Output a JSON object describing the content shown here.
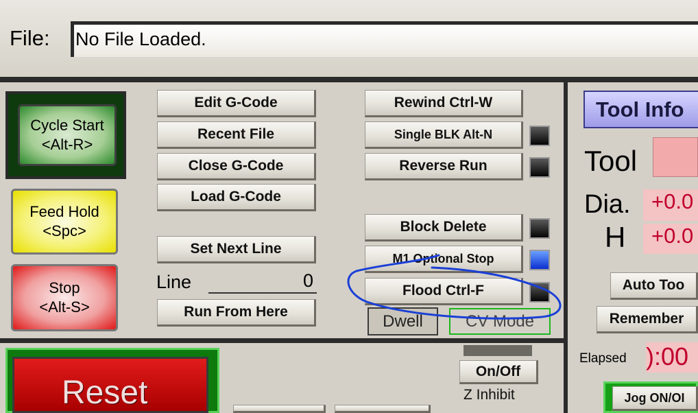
{
  "file": {
    "label": "File:",
    "value": "No File Loaded."
  },
  "buttons": {
    "cycle_start": [
      "Cycle Start",
      "<Alt-R>"
    ],
    "feed_hold": [
      "Feed Hold",
      "<Spc>"
    ],
    "stop": [
      "Stop",
      "<Alt-S>"
    ],
    "edit_gcode": "Edit G-Code",
    "recent_file": "Recent File",
    "close_gcode": "Close G-Code",
    "load_gcode": "Load G-Code",
    "set_next_line": "Set Next Line",
    "run_from_here": "Run From Here",
    "rewind": "Rewind Ctrl-W",
    "single_blk": "Single BLK Alt-N",
    "reverse_run": "Reverse Run",
    "block_delete": "Block Delete",
    "m1_optional_stop": "M1 Optional Stop",
    "flood": "Flood Ctrl-F",
    "dwell": "Dwell",
    "cv_mode": "CV Mode",
    "reset": "Reset",
    "on_off": "On/Off",
    "z_inhibit": "Z Inhibit",
    "auto_tool": "Auto Too",
    "remember": "Remember",
    "jog_on_off": "Jog ON/OI"
  },
  "line": {
    "label": "Line",
    "value": "0"
  },
  "tool_info": {
    "title": "Tool Info",
    "tool_label": "Tool",
    "dia_label": "Dia.",
    "dia_value": "+0.0",
    "h_label": "H",
    "h_value": "+0.0",
    "elapsed_label": "Elapsed",
    "elapsed_value": "):00"
  },
  "colors": {
    "annotation": "#1a3fd6",
    "led_on": "#1e5bff"
  }
}
